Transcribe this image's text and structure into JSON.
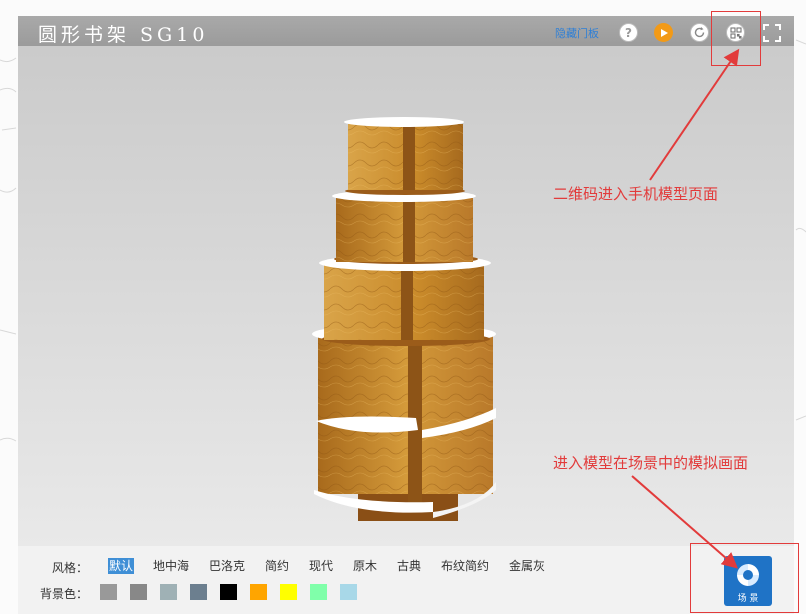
{
  "header": {
    "title": "圆形书架 SG10",
    "hide_door_label": "隐藏门板",
    "help_symbol": "?"
  },
  "toolbar": {
    "style_label": "风格：",
    "styles": [
      "默认",
      "地中海",
      "巴洛克",
      "简约",
      "现代",
      "原木",
      "古典",
      "布纹简约",
      "金属灰"
    ],
    "active_style": "默认",
    "bg_label": "背景色：",
    "bg_colors": [
      "#999999",
      "#888888",
      "#9fb1b5",
      "#6c7f8f",
      "#000000",
      "#ffa500",
      "#ffff00",
      "#80ffaa",
      "#a8d8e8"
    ]
  },
  "scene_button": {
    "label": "场 景"
  },
  "annotations": {
    "qr_note": "二维码进入手机模型页面",
    "scene_note": "进入模型在场景中的模拟画面"
  },
  "colors": {
    "accent": "#f29a17",
    "link": "#2e7fd6",
    "annotation": "#e23b3b",
    "scene_button": "#1f73c6",
    "wood": "#c98a2a"
  },
  "icons": [
    "help-icon",
    "play-icon",
    "rotate-icon",
    "qr-code-icon",
    "fullscreen-icon",
    "scene-icon"
  ]
}
